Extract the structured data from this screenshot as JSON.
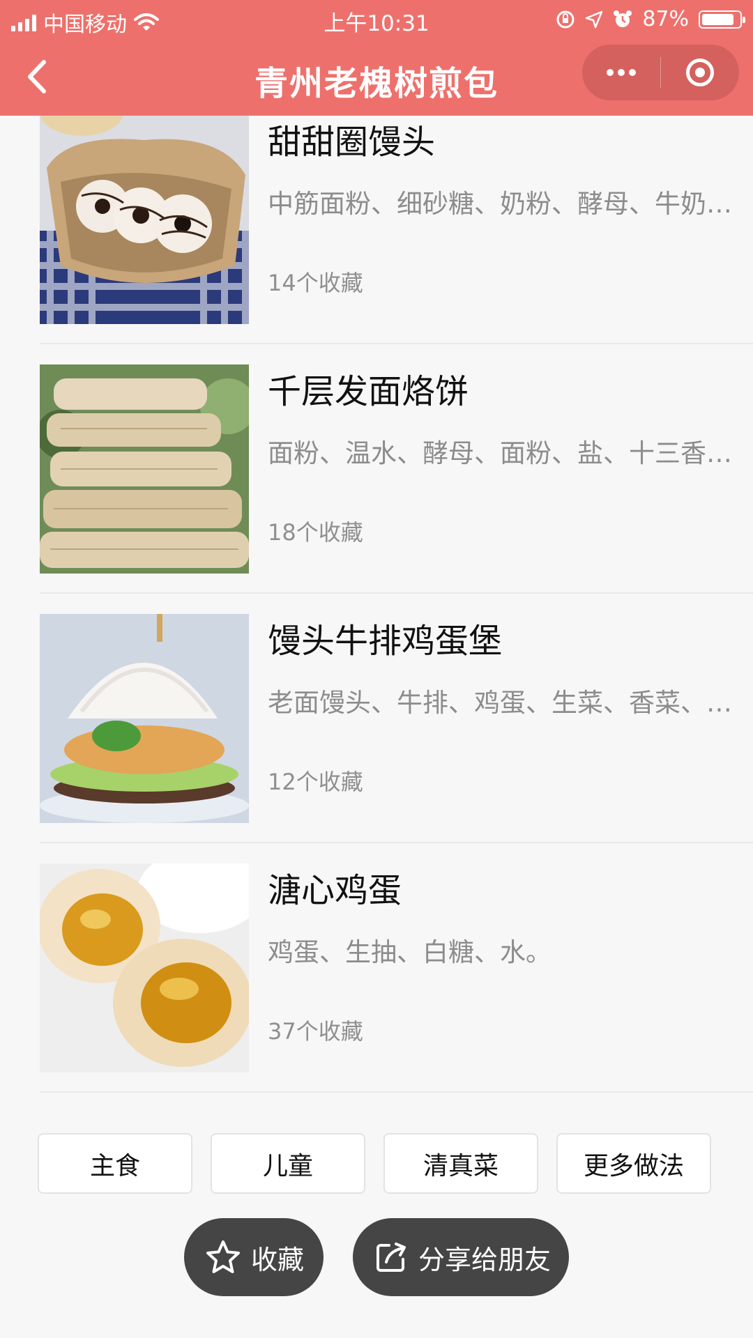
{
  "status_bar": {
    "carrier": "中国移动",
    "time": "上午10:31",
    "battery_percent": "87%",
    "battery_level": 0.87
  },
  "nav": {
    "title": "青州老槐树煎包",
    "back_icon": "chevron-left-icon",
    "more_icon": "more-dots-icon",
    "close_icon": "target-circle-icon"
  },
  "recipes": [
    {
      "name": "甜甜圈馒头",
      "ingredients": "中筋面粉、细砂糖、奶粉、酵母、牛奶、巧克力",
      "favorites": "14个收藏"
    },
    {
      "name": "千层发面烙饼",
      "ingredients": "面粉、温水、酵母、面粉、盐、十三香、油",
      "favorites": "18个收藏"
    },
    {
      "name": "馒头牛排鸡蛋堡",
      "ingredients": "老面馒头、牛排、鸡蛋、生菜、香菜、酱料",
      "favorites": "12个收藏"
    },
    {
      "name": "溏心鸡蛋",
      "ingredients": "鸡蛋、生抽、白糖、水。",
      "favorites": "37个收藏"
    }
  ],
  "categories": [
    "主食",
    "儿童",
    "清真菜",
    "更多做法"
  ],
  "actions": {
    "favorite_label": "收藏",
    "share_label": "分享给朋友",
    "favorite_icon": "star-icon",
    "share_icon": "share-icon"
  }
}
